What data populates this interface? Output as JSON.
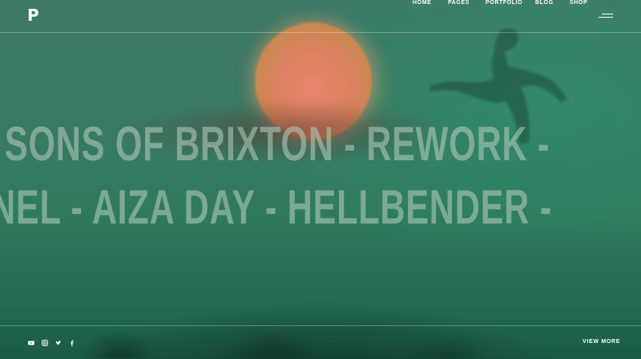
{
  "brand": {
    "logo_text": "P"
  },
  "nav": {
    "items": [
      {
        "label": "HOME"
      },
      {
        "label": "PAGES"
      },
      {
        "label": "PORTFOLIO"
      },
      {
        "label": "BLOG"
      },
      {
        "label": "SHOP"
      }
    ],
    "menu_icon": "hamburger-icon"
  },
  "marquee": {
    "line1": "- SONS OF BRIXTON  - REWORK  -",
    "line2": "NEL  - AIZA DAY  - HELLBENDER  -"
  },
  "footer": {
    "social_icons": [
      "youtube-icon",
      "instagram-icon",
      "twitter-icon",
      "facebook-icon"
    ],
    "view_more_label": "VIEW MORE"
  },
  "colors": {
    "accent": "#ffffff",
    "background": "#2f7a5d",
    "moon": "#e07f66"
  }
}
